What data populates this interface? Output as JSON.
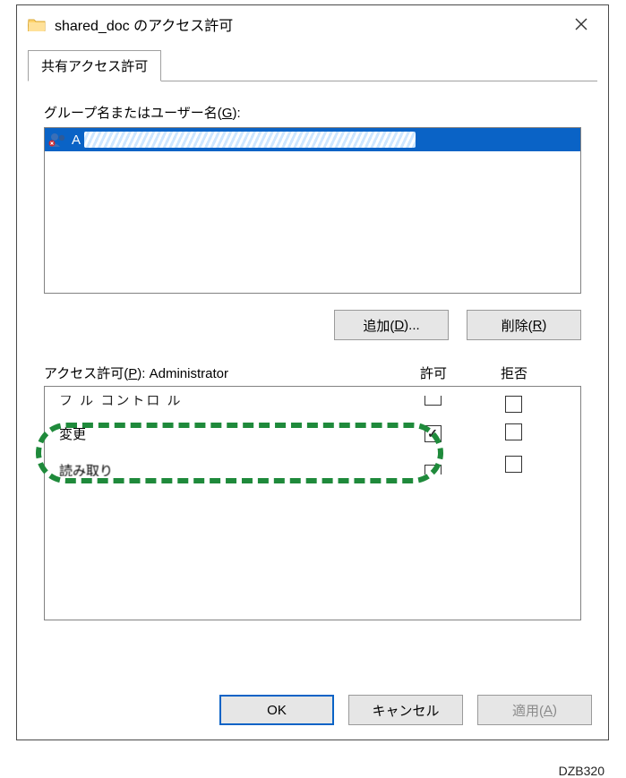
{
  "title": "shared_doc のアクセス許可",
  "tab_label": "共有アクセス許可",
  "group_label_pre": "グループ名またはユーザー名(",
  "group_label_key": "G",
  "group_label_post": "):",
  "list_selected_prefix": "A",
  "add_btn_pre": "追加(",
  "add_btn_key": "D",
  "add_btn_post": ")...",
  "remove_btn_pre": "削除(",
  "remove_btn_key": "R",
  "remove_btn_post": ")",
  "perm_label_pre": "アクセス許可(",
  "perm_label_key": "P",
  "perm_label_post": "): Administrator",
  "col_allow": "許可",
  "col_deny": "拒否",
  "perm_rows": {
    "row0_name_partial": "フ   ル   コントロ   ル",
    "row1_name": "変更",
    "row2_name_partial": "読み取り"
  },
  "ok_btn": "OK",
  "cancel_btn": "キャンセル",
  "apply_btn_pre": "適用(",
  "apply_btn_key": "A",
  "apply_btn_post": ")",
  "caption": "DZB320"
}
